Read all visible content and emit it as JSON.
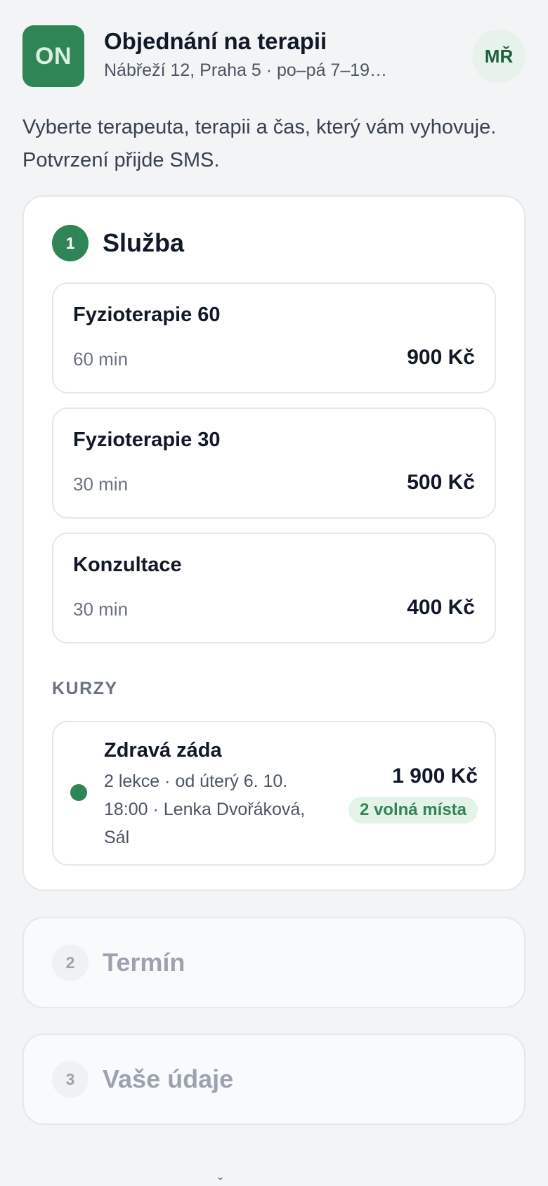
{
  "header": {
    "logo": "ON",
    "title": "Objednání na terapii",
    "subtitle": "Nábřeží 12, Praha 5 · po–pá 7–19…",
    "avatar": "MŘ"
  },
  "intro": "Vyberte terapeuta, terapii a čas, který vám vyhovuje. Potvrzení přijde SMS.",
  "steps": [
    {
      "number": "1",
      "title": "Služba"
    },
    {
      "number": "2",
      "title": "Termín"
    },
    {
      "number": "3",
      "title": "Vaše údaje"
    }
  ],
  "services": [
    {
      "name": "Fyzioterapie 60",
      "duration": "60 min",
      "price": "900 Kč"
    },
    {
      "name": "Fyzioterapie 30",
      "duration": "30 min",
      "price": "500 Kč"
    },
    {
      "name": "Konzultace",
      "duration": "30 min",
      "price": "400 Kč"
    }
  ],
  "courses": {
    "label": "KURZY",
    "items": [
      {
        "name": "Zdravá záda",
        "meta": "2 lekce · od úterý 6. 10. 18:00 · Lenka Dvořáková, Sál",
        "price": "1 900 Kč",
        "availability": "2 volná místa"
      }
    ]
  },
  "footer_mark": "ˇ",
  "colors": {
    "accent": "#2f8555",
    "background": "#f3f4f6",
    "badge_bg": "#e3f3e8"
  }
}
